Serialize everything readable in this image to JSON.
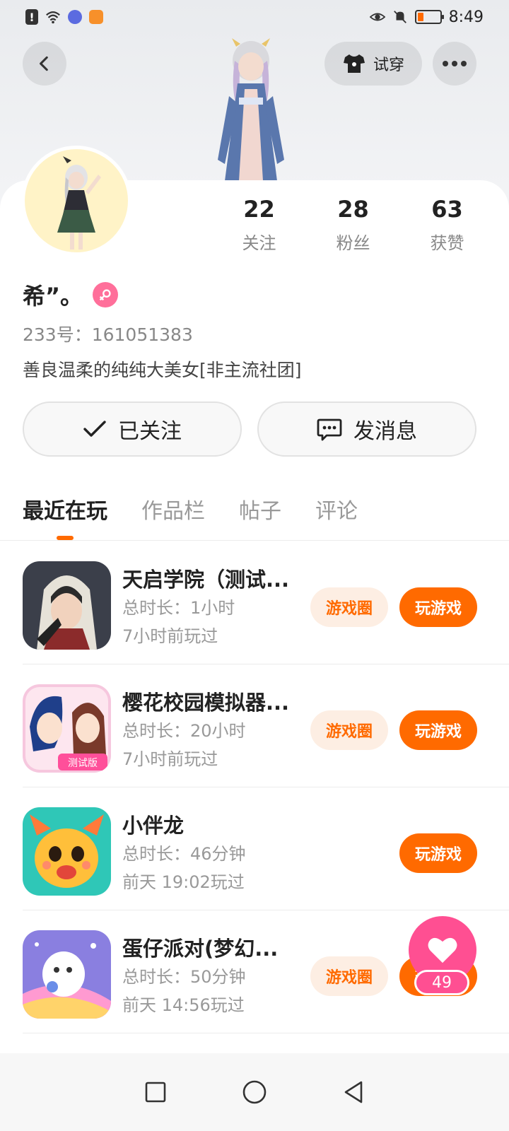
{
  "status_bar": {
    "time": "8:49"
  },
  "header": {
    "tryon_label": "试穿"
  },
  "stats": [
    {
      "value": "22",
      "label": "关注"
    },
    {
      "value": "28",
      "label": "粉丝"
    },
    {
      "value": "63",
      "label": "获赞"
    }
  ],
  "profile": {
    "name": "希”。",
    "uid": "233号：161051383",
    "bio": "善良温柔的纯纯大美女[非主流社团]"
  },
  "actions": {
    "follow_label": "已关注",
    "message_label": "发消息"
  },
  "tabs": [
    {
      "label": "最近在玩",
      "active": true
    },
    {
      "label": "作品栏",
      "active": false
    },
    {
      "label": "帖子",
      "active": false
    },
    {
      "label": "评论",
      "active": false
    }
  ],
  "games": [
    {
      "title": "天启学院（测试...",
      "duration": "总时长：1小时",
      "last_played": "7小时前玩过",
      "circle_label": "游戏圈",
      "play_label": "玩游戏"
    },
    {
      "title": "樱花校园模拟器...",
      "duration": "总时长：20小时",
      "last_played": "7小时前玩过",
      "circle_label": "游戏圈",
      "play_label": "玩游戏"
    },
    {
      "title": "小伴龙",
      "duration": "总时长：46分钟",
      "last_played": "前天 19:02玩过",
      "play_label": "玩游戏"
    },
    {
      "title": "蛋仔派对(梦幻...",
      "duration": "总时长：50分钟",
      "last_played": "前天 14:56玩过",
      "circle_label": "游戏圈",
      "play_label": "玩游戏"
    }
  ],
  "like": {
    "count": "49"
  },
  "colors": {
    "accent": "#ff6a00",
    "like_pink": "#ff4f92"
  }
}
